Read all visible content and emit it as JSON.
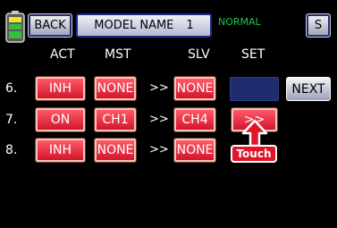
{
  "header": {
    "back_label": "BACK",
    "model_label": "MODEL NAME",
    "model_number": "1",
    "mode_label": "NORMAL",
    "s_label": "S"
  },
  "columns": {
    "act": "ACT",
    "mst": "MST",
    "slv": "SLV",
    "set": "SET"
  },
  "rows": [
    {
      "num": "6.",
      "act": "INH",
      "mst": "NONE",
      "arrow": ">>",
      "slv": "NONE",
      "set": ""
    },
    {
      "num": "7.",
      "act": "ON",
      "mst": "CH1",
      "arrow": ">>",
      "slv": "CH4",
      "set": ">>"
    },
    {
      "num": "8.",
      "act": "INH",
      "mst": "NONE",
      "arrow": ">>",
      "slv": "NONE",
      "set": ""
    }
  ],
  "next_label": "NEXT",
  "touch_label": "Touch",
  "colors": {
    "accent_red": "#e01628",
    "mode_green": "#22c44a",
    "set_navy": "#1e2d6e"
  }
}
